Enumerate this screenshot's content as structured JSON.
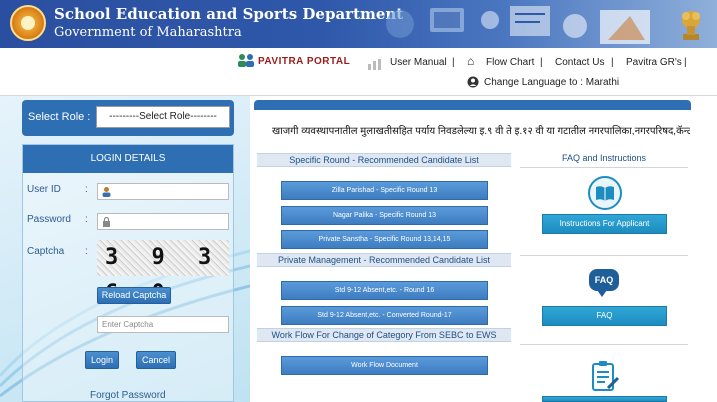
{
  "header": {
    "title": "School Education and Sports Department",
    "subtitle": "Government of Maharashtra"
  },
  "nav": {
    "portal": "PAVITRA PORTAL",
    "user_manual": "User Manual",
    "flow_chart": "Flow Chart",
    "contact_us": "Contact Us",
    "pavitra_grs": "Pavitra GR's",
    "change_language": "Change Language to : Marathi",
    "separator": "|"
  },
  "role": {
    "label": "Select Role :",
    "selected": "---------Select Role--------"
  },
  "login": {
    "heading": "LOGIN DETAILS",
    "user_id_label": "User ID",
    "password_label": "Password",
    "captcha_label": "Captcha",
    "colon": ":",
    "captcha_text": "3 9 3 6 0",
    "reload_label": "Reload Captcha",
    "captcha_placeholder": "Enter Captcha",
    "login_label": "Login",
    "cancel_label": "Cancel",
    "forgot_label": "Forgot Password"
  },
  "main": {
    "ticker": "खाजगी व्यवस्थापनातील मुलाखतीसहित पर्याय निवडलेल्या इ.९ वी ते इ.१२ वी या गटातील नगरपालिका,नगरपरिषद,कॅन्टोन्मेंट झालेल",
    "specific_round_title": "Specific Round - Recommended Candidate List",
    "specific_round_links": [
      "Zilla Parishad - Specific Round 13",
      "Nagar Palika - Specific Round 13",
      "Private Sanstha - Specific Round 13,14,15"
    ],
    "private_mgmt_title": "Private Management - Recommended Candidate List",
    "private_mgmt_links": [
      "Std 9-12 Absent,etc. - Round 16",
      "Std 9-12 Absent,etc. - Converted Round-17"
    ],
    "workflow_title": "Work Flow For Change of Category From SEBC to EWS",
    "workflow_link": "Work Flow Document"
  },
  "faq": {
    "heading": "FAQ and Instructions",
    "instructions_label": "Instructions For Applicant",
    "faq_icon_text": "FAQ",
    "faq_label": "FAQ"
  },
  "colors": {
    "primary_blue": "#2e6fb3",
    "portal_red": "#9b1c1c",
    "faq_blue": "#1d8cc0"
  }
}
